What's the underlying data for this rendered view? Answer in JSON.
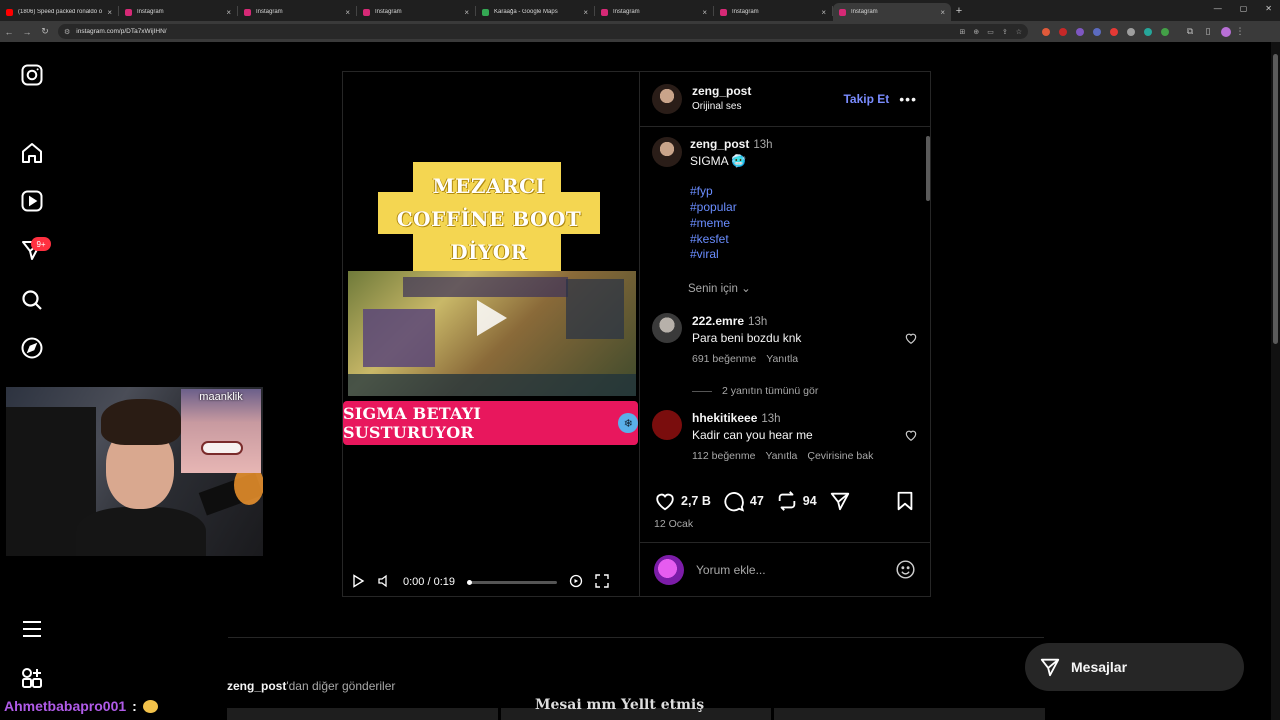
{
  "browser": {
    "tabs": [
      {
        "title": "(1806) Speed packed ronaldo o",
        "favicon_color": "#ff0000",
        "active": false
      },
      {
        "title": "Instagram",
        "favicon_color": "#d62976",
        "active": false
      },
      {
        "title": "Instagram",
        "favicon_color": "#d62976",
        "active": false
      },
      {
        "title": "Instagram",
        "favicon_color": "#d62976",
        "active": false
      },
      {
        "title": "Karaağa - Google Maps",
        "favicon_color": "#34a853",
        "active": false
      },
      {
        "title": "Instagram",
        "favicon_color": "#d62976",
        "active": false
      },
      {
        "title": "Instagram",
        "favicon_color": "#d62976",
        "active": false
      },
      {
        "title": "Instagram",
        "favicon_color": "#d62976",
        "active": true
      }
    ],
    "url": "instagram.com/p/DTa7xWijIHN/",
    "extension_colors": [
      "#e05a3a",
      "#c62828",
      "#7e57c2",
      "#5c6bc0",
      "#e53935",
      "#9e9e9e",
      "#26a69a",
      "#43a047"
    ]
  },
  "sidebar": {
    "notification_badge": "9+"
  },
  "post": {
    "username": "zeng_post",
    "audio": "Orijinal ses",
    "follow_label": "Takip Et",
    "more_label": "•••",
    "video": {
      "overlay_top": "MEZARCI\nCOFFİNE BOOT\nDİYOR",
      "overlay_bottom": "SIGMA BETAYI SUSTURUYOR",
      "time": "0:00 / 0:19",
      "progress": 0
    },
    "caption": {
      "username": "zeng_post",
      "time": "13h",
      "text": "SIGMA 🥶",
      "hashtags": [
        "#fyp",
        "#popular",
        "#meme",
        "#kesfet",
        "#viral"
      ]
    },
    "for_you_label": "Senin için",
    "comments": [
      {
        "username": "222.emre",
        "time": "13h",
        "text": "Para beni bozdu knk",
        "likes": "691 beğenme",
        "reply": "Yanıtla",
        "translate": ""
      },
      {
        "username": "hhekitikeee",
        "time": "13h",
        "text": "Kadir can you hear me",
        "likes": "112 beğenme",
        "reply": "Yanıtla",
        "translate": "Çevirisine bak"
      }
    ],
    "replies_label": "2 yanıtın tümünü gör",
    "likes_count": "2,7 B",
    "comments_count": "47",
    "reposts_count": "94",
    "date": "12 Ocak",
    "add_comment_placeholder": "Yorum ekle..."
  },
  "more_posts": {
    "username": "zeng_post",
    "suffix": "'dan diğer gönderiler",
    "strip_text": "Mesai mm Yellt etmiş"
  },
  "messages_label": "Mesajlar",
  "stream": {
    "sticker_name": "maanklik",
    "chat_user": "Ahmetbabapro001",
    "chat_sep": ":"
  }
}
